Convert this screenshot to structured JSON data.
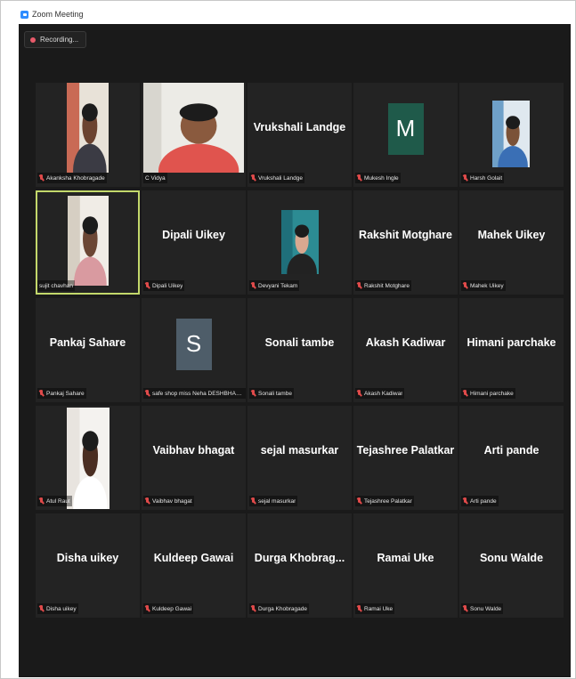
{
  "window": {
    "title": "Zoom Meeting"
  },
  "recording": {
    "label": "Recording..."
  },
  "colors": {
    "active_border": "#c3d86b",
    "muted_mic": "#e04a4a",
    "avatar_m": "#1f5a4a",
    "avatar_s": "#4e5d69"
  },
  "participants": [
    {
      "display": "",
      "label": "Akanksha Khobragade",
      "type": "video",
      "muted": true
    },
    {
      "display": "",
      "label": "C Vidya",
      "type": "video",
      "muted": false
    },
    {
      "display": "Vrukshali Landge",
      "label": "Vrukshali Landge",
      "type": "name",
      "muted": true
    },
    {
      "display": "M",
      "label": "Mukesh Ingle",
      "type": "avatar-m",
      "muted": true
    },
    {
      "display": "",
      "label": "Harsh Golait",
      "type": "photo",
      "muted": true
    },
    {
      "display": "",
      "label": "sujit chavhan",
      "type": "video",
      "muted": false,
      "active": true
    },
    {
      "display": "Dipali Uikey",
      "label": "Dipali Uikey",
      "type": "name",
      "muted": true
    },
    {
      "display": "",
      "label": "Devyani Tekam",
      "type": "photo",
      "muted": true
    },
    {
      "display": "Rakshit Motghare",
      "label": "Rakshit Motghare",
      "type": "name",
      "muted": true
    },
    {
      "display": "Mahek Uikey",
      "label": "Mahek Uikey",
      "type": "name",
      "muted": true
    },
    {
      "display": "Pankaj Sahare",
      "label": "Pankaj Sahare",
      "type": "name",
      "muted": true
    },
    {
      "display": "S",
      "label": "safe shop miss Neha DESHBHART...",
      "type": "avatar-s",
      "muted": true
    },
    {
      "display": "Sonali tambe",
      "label": "Sonali tambe",
      "type": "name",
      "muted": true
    },
    {
      "display": "Akash Kadiwar",
      "label": "Akash Kadiwar",
      "type": "name",
      "muted": true
    },
    {
      "display": "Himani parchake",
      "label": "Himani parchake",
      "type": "name",
      "muted": true
    },
    {
      "display": "",
      "label": "Atul Raut",
      "type": "video",
      "muted": true
    },
    {
      "display": "Vaibhav bhagat",
      "label": "Vaibhav bhagat",
      "type": "name",
      "muted": true
    },
    {
      "display": "sejal masurkar",
      "label": "sejal masurkar",
      "type": "name",
      "muted": true
    },
    {
      "display": "Tejashree Palatkar",
      "label": "Tejashree Palatkar",
      "type": "name",
      "muted": true
    },
    {
      "display": "Arti pande",
      "label": "Arti pande",
      "type": "name",
      "muted": true
    },
    {
      "display": "Disha uikey",
      "label": "Disha uikey",
      "type": "name",
      "muted": true
    },
    {
      "display": "Kuldeep Gawai",
      "label": "Kuldeep Gawai",
      "type": "name",
      "muted": true
    },
    {
      "display": "Durga Khobrag...",
      "label": "Durga Khobragade",
      "type": "name",
      "muted": true
    },
    {
      "display": "Ramai Uke",
      "label": "Ramai Uke",
      "type": "name",
      "muted": true
    },
    {
      "display": "Sonu Walde",
      "label": "Sonu Walde",
      "type": "name",
      "muted": true
    }
  ]
}
